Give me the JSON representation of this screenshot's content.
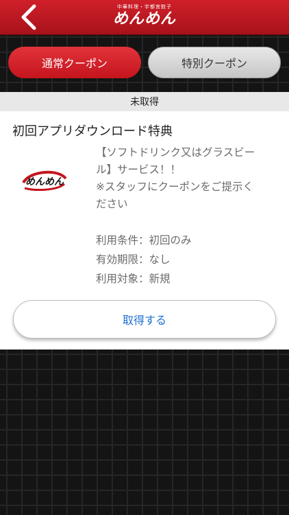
{
  "header": {
    "logo_subtitle": "中華料理・宇都宮餃子",
    "logo_text": "めんめん",
    "back_icon": "chevron-left-icon"
  },
  "tabs": [
    {
      "label": "通常クーポン",
      "active": true
    },
    {
      "label": "特別クーポン",
      "active": false
    }
  ],
  "coupon": {
    "status": "未取得",
    "title": "初回アプリダウンロード特典",
    "logo_text": "めんめん",
    "description_lines": [
      "【ソフトドリンク又はグラスビー",
      "ル】サービス！！",
      "※スタッフにクーポンをご提示く",
      "ださい"
    ],
    "conditions": [
      "利用条件：初回のみ",
      "有効期限：なし",
      "利用対象：新規"
    ],
    "button_label": "取得する"
  },
  "colors": {
    "header_red": "#c4141d",
    "button_text_blue": "#1d6fd1"
  }
}
